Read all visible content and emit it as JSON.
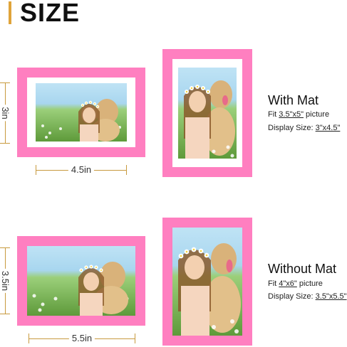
{
  "header": {
    "title": "SIZE"
  },
  "with_mat": {
    "heading": "With Mat",
    "fit_prefix": "Fit ",
    "fit_value": "3.5\"x5\"",
    "fit_suffix": " picture",
    "display_prefix": "Display Size: ",
    "display_value": "3\"x4.5\"",
    "width_label": "4.5in",
    "height_label": "3in"
  },
  "without_mat": {
    "heading": "Without Mat",
    "fit_prefix": "Fit ",
    "fit_value": "4\"x6\"",
    "fit_suffix": " picture",
    "display_prefix": "Display Size: ",
    "display_value": "3.5\"x5.5\"",
    "width_label": "5.5in",
    "height_label": "3.5in"
  },
  "colors": {
    "frame": "#ff7fc0",
    "accent": "#e0a43a",
    "dimension": "#c89a3e"
  }
}
